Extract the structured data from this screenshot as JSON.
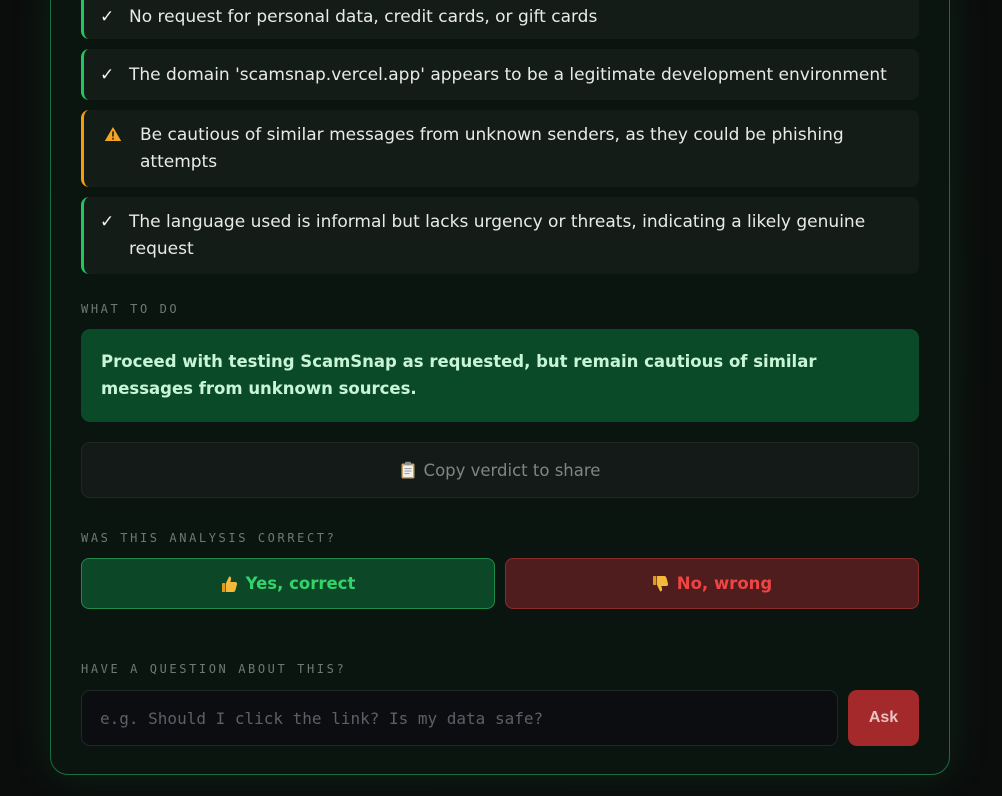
{
  "findings": [
    {
      "type": "ok",
      "mark": "✓",
      "text": "No request for personal data, credit cards, or gift cards"
    },
    {
      "type": "ok",
      "mark": "✓",
      "text": "The domain 'scamsnap.vercel.app' appears to be a legitimate development environment"
    },
    {
      "type": "warn",
      "icon": "warning-icon",
      "text": "Be cautious of similar messages from unknown senders, as they could be phishing attempts"
    },
    {
      "type": "ok",
      "mark": "✓",
      "text": "The language used is informal but lacks urgency or threats, indicating a likely genuine request"
    }
  ],
  "what_to_do": {
    "label": "WHAT TO DO",
    "text": "Proceed with testing ScamSnap as requested, but remain cautious of similar messages from unknown sources."
  },
  "copy": {
    "icon": "clipboard-icon",
    "label": "Copy verdict to share"
  },
  "feedback": {
    "label": "WAS THIS ANALYSIS CORRECT?",
    "yes": {
      "icon": "thumbs-up-icon",
      "label": "Yes, correct"
    },
    "no": {
      "icon": "thumbs-down-icon",
      "label": "No, wrong"
    }
  },
  "question": {
    "label": "HAVE A QUESTION ABOUT THIS?",
    "placeholder": "e.g. Should I click the link? Is my data safe?",
    "value": "",
    "ask_label": "Ask"
  },
  "colors": {
    "ok_border": "#22c55e",
    "warn_border": "#f59e0b",
    "advice_bg": "#0b4a29",
    "yes_text": "#34d36a",
    "no_text": "#ef4444",
    "ask_bg": "#a3292b"
  }
}
